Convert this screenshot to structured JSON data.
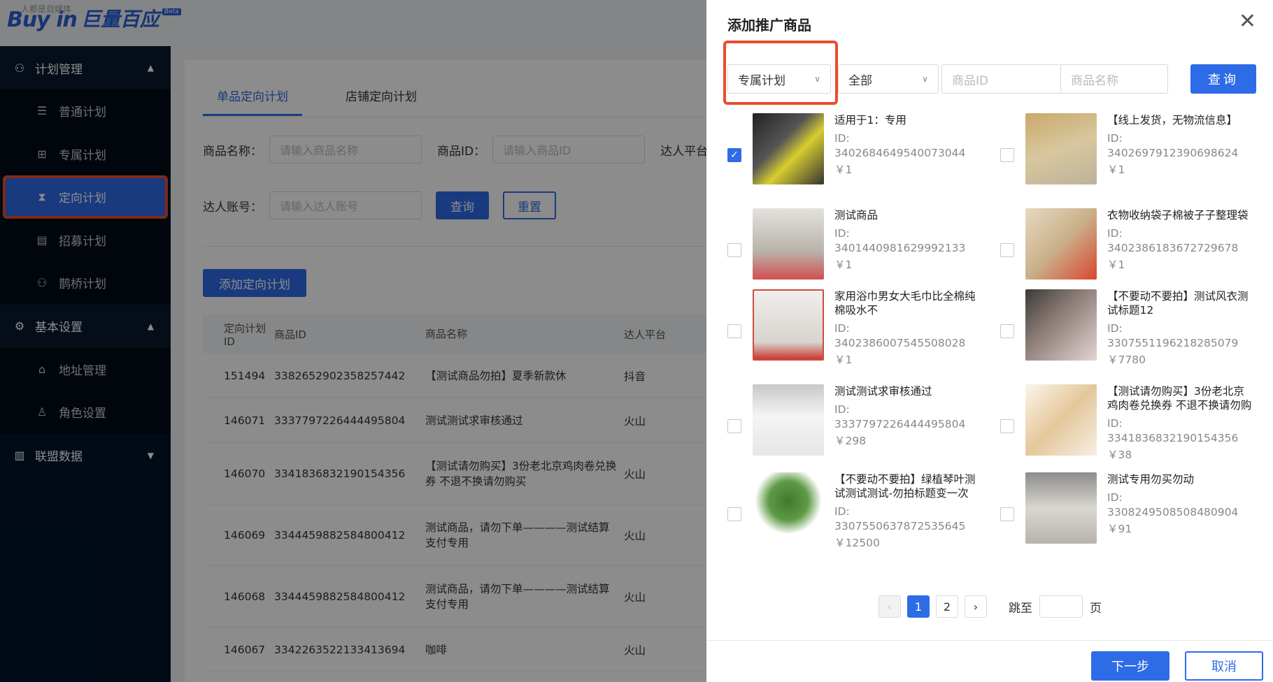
{
  "logo": {
    "main": "Buy in",
    "cn": "巨量百应",
    "beta": "Beta",
    "sub": "人都是自媒体"
  },
  "sidebar": {
    "groups": [
      {
        "label": "计划管理",
        "icon": "user-group-icon",
        "chevron": "up"
      },
      {
        "label": "基本设置",
        "icon": "gear-icon",
        "chevron": "up"
      },
      {
        "label": "联盟数据",
        "icon": "bar-chart-icon",
        "chevron": "down"
      }
    ],
    "items": [
      {
        "label": "普通计划",
        "icon": "list-icon"
      },
      {
        "label": "专属计划",
        "icon": "gift-icon"
      },
      {
        "label": "定向计划",
        "icon": "hourglass-icon",
        "active": true
      },
      {
        "label": "招募计划",
        "icon": "document-icon"
      },
      {
        "label": "鹊桥计划",
        "icon": "users-icon"
      },
      {
        "label": "地址管理",
        "icon": "home-icon"
      },
      {
        "label": "角色设置",
        "icon": "person-icon"
      }
    ]
  },
  "main": {
    "tabs": [
      {
        "label": "单品定向计划",
        "active": true
      },
      {
        "label": "店铺定向计划",
        "active": false
      }
    ],
    "form": {
      "product_name_label": "商品名称：",
      "product_name_placeholder": "请输入商品名称",
      "product_id_label": "商品ID：",
      "product_id_placeholder": "请输入商品ID",
      "platform_label": "达人平台：",
      "account_label": "达人账号：",
      "account_placeholder": "请输入达人账号",
      "query": "查询",
      "reset": "重置"
    },
    "add_button": "添加定向计划",
    "table": {
      "headers": [
        "定向计划ID",
        "商品ID",
        "商品名称",
        "达人平台"
      ],
      "rows": [
        {
          "id": "151494",
          "pid": "3382652902358257442",
          "name": "【测试商品勿拍】夏季新款休",
          "platform": "抖音"
        },
        {
          "id": "146071",
          "pid": "3337797226444495804",
          "name": "测试测试求审核通过",
          "platform": "火山"
        },
        {
          "id": "146070",
          "pid": "3341836832190154356",
          "name": "【测试请勿购买】3份老北京鸡肉卷兑换券 不退不换请勿购买",
          "platform": "火山"
        },
        {
          "id": "146069",
          "pid": "3344459882584800412",
          "name": "测试商品，请勿下单————测试结算支付专用",
          "platform": "火山"
        },
        {
          "id": "146068",
          "pid": "3344459882584800412",
          "name": "测试商品，请勿下单————测试结算支付专用",
          "platform": "火山"
        },
        {
          "id": "146067",
          "pid": "3342263522133413694",
          "name": "咖啡",
          "platform": "火山"
        }
      ]
    }
  },
  "drawer": {
    "title": "添加推广商品",
    "plan_select": "专属计划",
    "status_select": "全部",
    "product_id_placeholder": "商品ID",
    "product_name_placeholder": "商品名称",
    "query": "查询",
    "id_label": "ID:",
    "products": [
      {
        "name": "适用于1：专用",
        "id": "3402684649540073044",
        "price": "￥1",
        "checked": true
      },
      {
        "name": "【线上发货，无物流信息】",
        "id": "3402697912390698624",
        "price": "￥1",
        "checked": false
      },
      {
        "name": "测试商品",
        "id": "3401440981629992133",
        "price": "￥1",
        "checked": false
      },
      {
        "name": "衣物收纳袋子棉被子子整理袋",
        "id": "3402386183672729678",
        "price": "￥1",
        "checked": false
      },
      {
        "name": "家用浴巾男女大毛巾比全棉纯棉吸水不",
        "id": "3402386007545508028",
        "price": "￥1",
        "checked": false
      },
      {
        "name": "【不要动不要拍】测试风衣测试标题12",
        "id": "3307551196218285079",
        "price": "￥7780",
        "checked": false
      },
      {
        "name": "测试测试求审核通过",
        "id": "3337797226444495804",
        "price": "￥298",
        "checked": false
      },
      {
        "name": "【测试请勿购买】3份老北京鸡肉卷兑换券 不退不换请勿购买",
        "id": "3341836832190154356",
        "price": "￥38",
        "checked": false
      },
      {
        "name": "【不要动不要拍】绿植琴叶测试测试测试-勿拍标题变一次",
        "id": "3307550637872535645",
        "price": "￥12500",
        "checked": false
      },
      {
        "name": "测试专用勿买勿动",
        "id": "3308249508508480904",
        "price": "￥91",
        "checked": false
      }
    ],
    "pager": {
      "pages": [
        "1",
        "2"
      ],
      "current": "1",
      "jump_label": "跳至",
      "page_suffix": "页"
    },
    "next": "下一步",
    "cancel": "取消"
  }
}
